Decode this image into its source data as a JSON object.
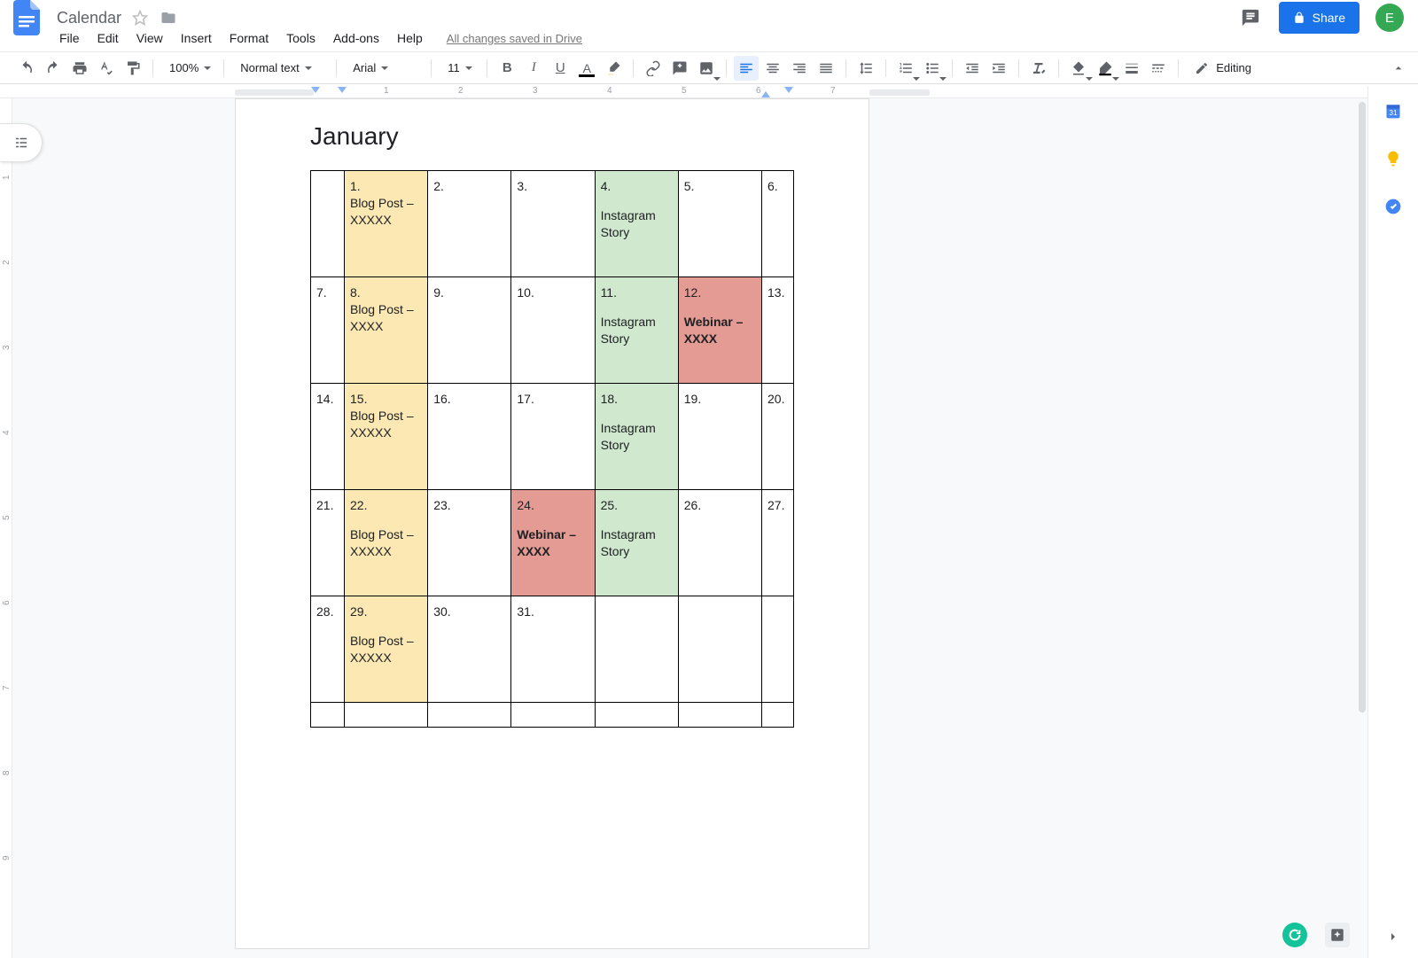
{
  "header": {
    "doc_title": "Calendar",
    "save_status": "All changes saved in Drive",
    "share_label": "Share",
    "avatar_letter": "E"
  },
  "menus": [
    "File",
    "Edit",
    "View",
    "Insert",
    "Format",
    "Tools",
    "Add-ons",
    "Help"
  ],
  "toolbar": {
    "zoom": "100%",
    "style": "Normal text",
    "font": "Arial",
    "font_size": "11",
    "mode": "Editing"
  },
  "ruler_h": [
    " ",
    "1",
    "2",
    "3",
    "4",
    "5",
    "6",
    "7"
  ],
  "ruler_v": [
    "1",
    "2",
    "3",
    "4",
    "5",
    "6",
    "7",
    "8",
    "9"
  ],
  "document": {
    "heading": "January",
    "rows": [
      [
        {
          "num": "",
          "note": "",
          "bg": ""
        },
        {
          "num": "1.",
          "note": "Blog Post  – XXXXX",
          "bg": "bg-yellow",
          "gap": false
        },
        {
          "num": "2.",
          "note": ""
        },
        {
          "num": "3.",
          "note": ""
        },
        {
          "num": "4.",
          "note": "Instagram Story",
          "bg": "bg-green",
          "gap": true
        },
        {
          "num": "5.",
          "note": ""
        },
        {
          "num": "6.",
          "note": ""
        }
      ],
      [
        {
          "num": "7.",
          "note": ""
        },
        {
          "num": "8.",
          "note": "Blog Post – XXXX",
          "bg": "bg-yellow",
          "gap": false
        },
        {
          "num": "9.",
          "note": ""
        },
        {
          "num": "10.",
          "note": ""
        },
        {
          "num": "11.",
          "note": "Instagram Story",
          "bg": "bg-green",
          "gap": true
        },
        {
          "num": "12.",
          "note": "Webinar – XXXX",
          "bg": "bg-red",
          "gap": true,
          "bold": true
        },
        {
          "num": "13.",
          "note": ""
        }
      ],
      [
        {
          "num": "14.",
          "note": ""
        },
        {
          "num": "15.",
          "note": "Blog Post  – XXXXX",
          "bg": "bg-yellow",
          "gap": false
        },
        {
          "num": "16.",
          "note": ""
        },
        {
          "num": "17.",
          "note": ""
        },
        {
          "num": "18.",
          "note": "Instagram Story",
          "bg": "bg-green",
          "gap": true
        },
        {
          "num": "19.",
          "note": ""
        },
        {
          "num": "20.",
          "note": ""
        }
      ],
      [
        {
          "num": "21.",
          "note": ""
        },
        {
          "num": "22.",
          "note": "Blog Post  – XXXXX",
          "bg": "bg-yellow",
          "gap": true
        },
        {
          "num": "23.",
          "note": ""
        },
        {
          "num": "24.",
          "note": "Webinar – XXXX",
          "bg": "bg-red",
          "gap": true,
          "bold": true
        },
        {
          "num": "25.",
          "note": "Instagram Story",
          "bg": "bg-green",
          "gap": true
        },
        {
          "num": "26.",
          "note": ""
        },
        {
          "num": "27.",
          "note": ""
        }
      ],
      [
        {
          "num": "28.",
          "note": ""
        },
        {
          "num": "29.",
          "note": "Blog Post  – XXXXX",
          "bg": "bg-yellow",
          "gap": true
        },
        {
          "num": "30.",
          "note": ""
        },
        {
          "num": "31.",
          "note": ""
        },
        {
          "num": "",
          "note": ""
        },
        {
          "num": "",
          "note": ""
        },
        {
          "num": "",
          "note": ""
        }
      ],
      [
        {
          "num": "",
          "note": ""
        },
        {
          "num": "",
          "note": ""
        },
        {
          "num": "",
          "note": ""
        },
        {
          "num": "",
          "note": ""
        },
        {
          "num": "",
          "note": ""
        },
        {
          "num": "",
          "note": ""
        },
        {
          "num": "",
          "note": ""
        }
      ]
    ]
  }
}
